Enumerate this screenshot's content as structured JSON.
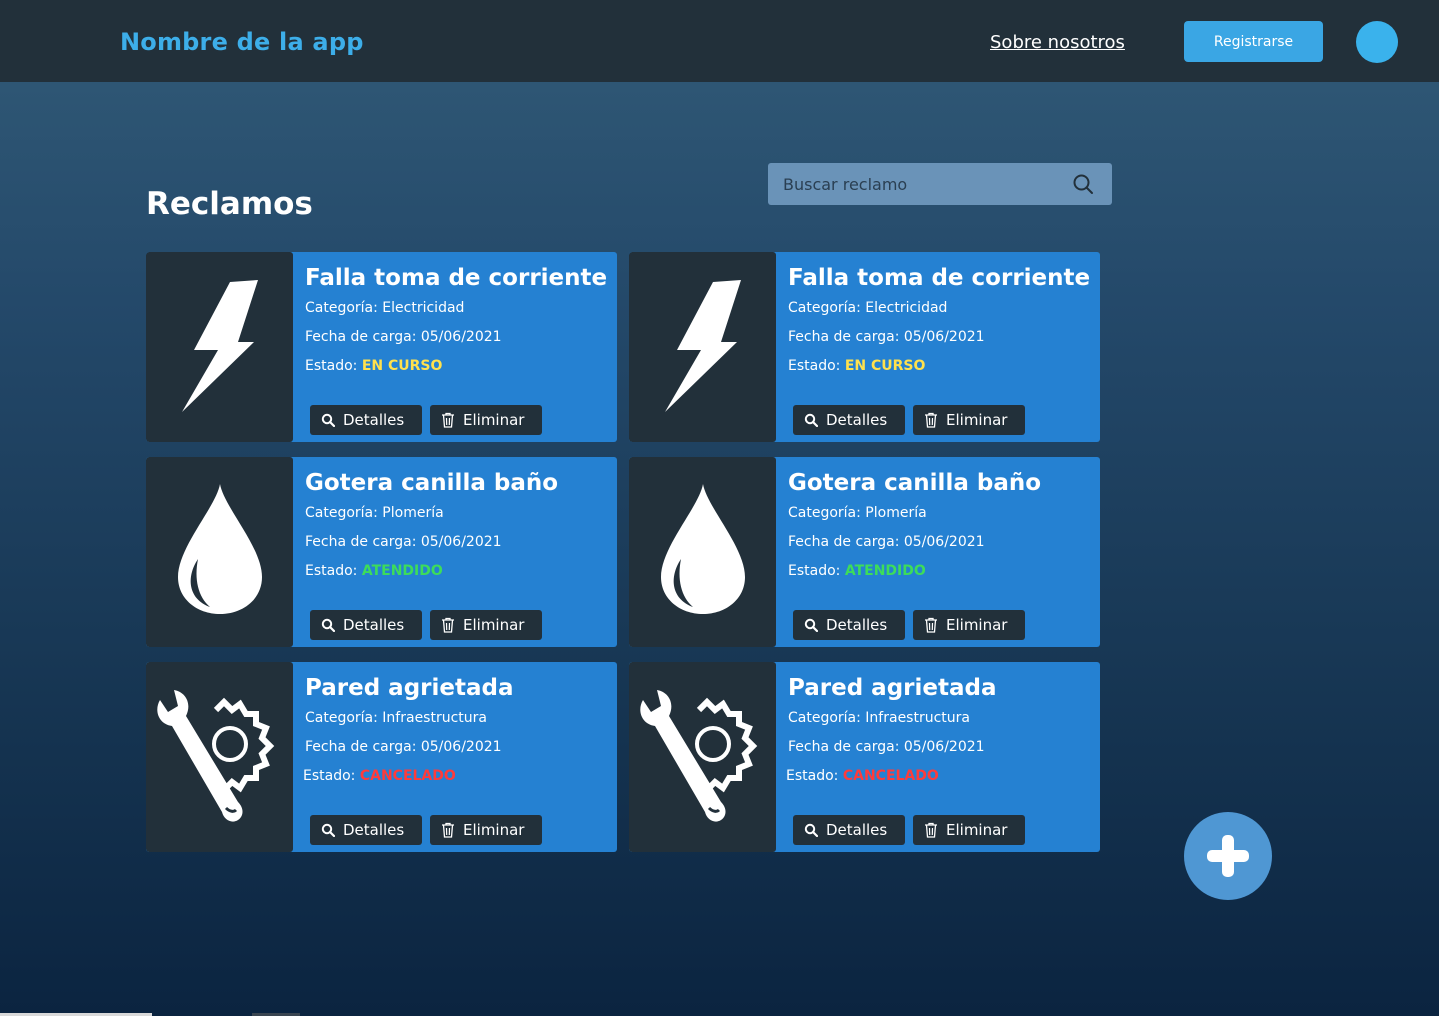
{
  "header": {
    "app_name": "Nombre de la app",
    "about_link": "Sobre nosotros",
    "register_label": "Registrarse"
  },
  "main": {
    "title": "Reclamos",
    "search": {
      "placeholder": "Buscar reclamo",
      "value": ""
    }
  },
  "cards": [
    {
      "title": "Falla toma de corriente",
      "category": "Categoría: Electricidad",
      "date": "Fecha de carga: 05/06/2021",
      "status_label": "Estado:",
      "status": "EN CURSO",
      "status_color": "#ffe14d",
      "icon": "lightning-icon"
    },
    {
      "title": "Falla toma de corriente",
      "category": "Categoría: Electricidad",
      "date": "Fecha de carga: 05/06/2021",
      "status_label": "Estado:",
      "status": "EN CURSO",
      "status_color": "#ffe14d",
      "icon": "lightning-icon"
    },
    {
      "title": "Gotera canilla baño",
      "category": "Categoría: Plomería",
      "date": "Fecha de carga: 05/06/2021",
      "status_label": "Estado:",
      "status": "ATENDIDO",
      "status_color": "#3ddc5a",
      "icon": "water-drop-icon"
    },
    {
      "title": "Gotera canilla baño",
      "category": "Categoría: Plomería",
      "date": "Fecha de carga: 05/06/2021",
      "status_label": "Estado:",
      "status": "ATENDIDO",
      "status_color": "#3ddc5a",
      "icon": "water-drop-icon"
    },
    {
      "title": "Pared agrietada",
      "category": "Categoría: Infraestructura",
      "date": "Fecha de carga: 05/06/2021",
      "status_label": "Estado:",
      "status": "CANCELADO",
      "status_color": "#ff3b3b",
      "icon": "wrench-gear-icon"
    },
    {
      "title": "Pared agrietada",
      "category": "Categoría: Infraestructura",
      "date": "Fecha de carga: 05/06/2021",
      "status_label": "Estado:",
      "status": "CANCELADO",
      "status_color": "#ff3b3b",
      "icon": "wrench-gear-icon"
    }
  ],
  "actions": {
    "details_label": "Detalles",
    "delete_label": "Eliminar"
  },
  "colors": {
    "accent": "#3aa6e4",
    "card": "#2581d2",
    "dark": "#22303a"
  }
}
